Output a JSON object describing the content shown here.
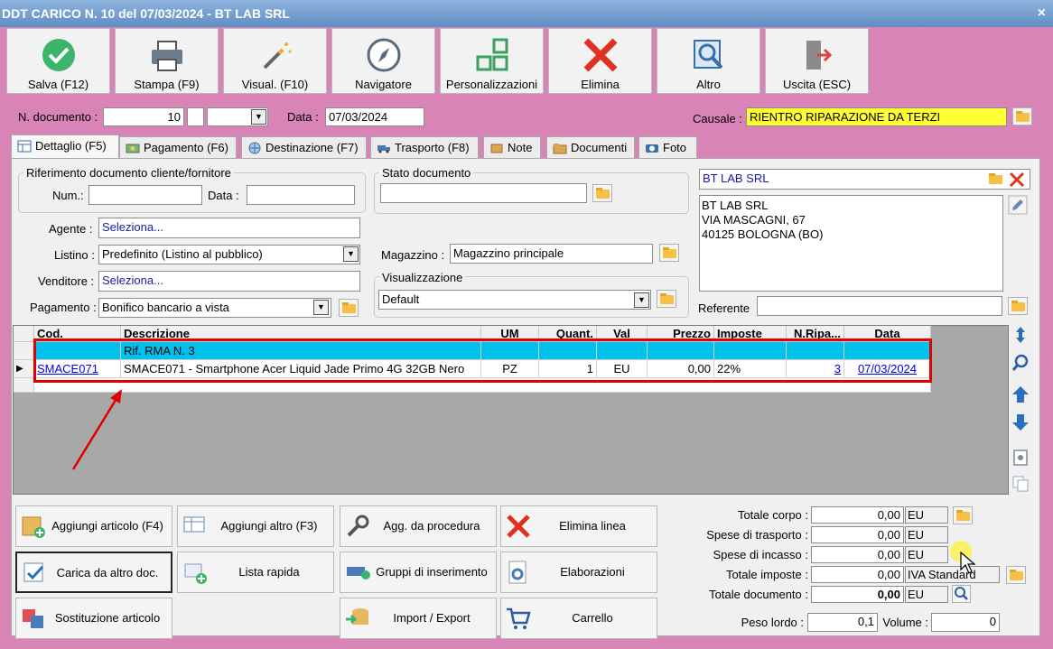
{
  "window": {
    "title": "DDT CARICO N. 10 del 07/03/2024 - BT LAB SRL",
    "close": "×"
  },
  "toolbar": [
    {
      "label": "Salva (F12)",
      "icon": "check-circle-icon"
    },
    {
      "label": "Stampa (F9)",
      "icon": "printer-icon"
    },
    {
      "label": "Visual. (F10)",
      "icon": "magic-wand-icon"
    },
    {
      "label": "Navigatore",
      "icon": "compass-icon"
    },
    {
      "label": "Personalizzazioni",
      "icon": "grid-squares-icon"
    },
    {
      "label": "Elimina",
      "icon": "red-x-icon"
    },
    {
      "label": "Altro",
      "icon": "magnifier-icon"
    },
    {
      "label": "Uscita (ESC)",
      "icon": "exit-door-icon"
    }
  ],
  "header": {
    "ndoc_label": "N. documento :",
    "ndoc_value": "10",
    "data_label": "Data :",
    "data_value": "07/03/2024",
    "causale_label": "Causale :",
    "causale_value": "RIENTRO RIPARAZIONE DA TERZI"
  },
  "tabs": [
    {
      "label": "Dettaglio (F5)",
      "icon": "table-icon",
      "active": true
    },
    {
      "label": "Pagamento (F6)",
      "icon": "money-icon"
    },
    {
      "label": "Destinazione (F7)",
      "icon": "globe-icon"
    },
    {
      "label": "Trasporto (F8)",
      "icon": "truck-icon"
    },
    {
      "label": "Note",
      "icon": "note-icon"
    },
    {
      "label": "Documenti",
      "icon": "folder-icon"
    },
    {
      "label": "Foto",
      "icon": "camera-icon"
    }
  ],
  "riferimento": {
    "title": "Riferimento documento cliente/fornitore",
    "num_label": "Num.:",
    "num_value": "",
    "data_label": "Data :",
    "data_value": ""
  },
  "stato": {
    "title": "Stato documento",
    "value": ""
  },
  "fields": {
    "agente_label": "Agente :",
    "agente_value": "Seleziona...",
    "listino_label": "Listino :",
    "listino_value": "Predefinito (Listino al pubblico)",
    "venditore_label": "Venditore :",
    "venditore_value": "Seleziona...",
    "pagamento_label": "Pagamento :",
    "pagamento_value": "Bonifico bancario a vista",
    "magazzino_label": "Magazzino :",
    "magazzino_value": "Magazzino principale",
    "visualizzazione_title": "Visualizzazione",
    "visualizzazione_value": "Default"
  },
  "cliente": {
    "name": "BT LAB SRL",
    "address_line1": "BT LAB SRL",
    "address_line2": "VIA MASCAGNI, 67",
    "address_line3": "40125 BOLOGNA (BO)",
    "referente_label": "Referente",
    "referente_value": ""
  },
  "grid": {
    "columns": [
      "Cod.",
      "Descrizione",
      "UM",
      "Quant.",
      "Val",
      "Prezzo",
      "Imposte",
      "N.Ripa...",
      "Data"
    ],
    "rows": [
      {
        "cod": "",
        "descrizione": "Rif. RMA N. 3",
        "um": "",
        "quant": "",
        "val": "",
        "prezzo": "",
        "imposte": "",
        "nripa": "",
        "data": ""
      },
      {
        "cod": "SMACE071",
        "descrizione": "SMACE071 - Smartphone Acer Liquid Jade Primo 4G 32GB Nero",
        "um": "PZ",
        "quant": "1",
        "val": "EU",
        "prezzo": "0,00",
        "imposte": "22%",
        "nripa": "3",
        "data": "07/03/2024"
      }
    ]
  },
  "actions": [
    {
      "label": "Aggiungi articolo (F4)",
      "icon": "add-article-icon"
    },
    {
      "label": "Aggiungi altro (F3)",
      "icon": "add-other-icon"
    },
    {
      "label": "Agg. da procedura",
      "icon": "wrench-icon"
    },
    {
      "label": "Elimina linea",
      "icon": "red-x-icon"
    },
    {
      "label": "Carica da altro doc.",
      "icon": "load-doc-icon"
    },
    {
      "label": "Lista rapida",
      "icon": "quick-list-icon"
    },
    {
      "label": "Gruppi di inserimento",
      "icon": "insert-group-icon"
    },
    {
      "label": "Elaborazioni",
      "icon": "process-gear-icon"
    },
    {
      "label": "Sostituzione articolo",
      "icon": "swap-icon"
    },
    {
      "label": "Import / Export",
      "icon": "import-export-icon"
    },
    {
      "label": "Carrello",
      "icon": "cart-icon"
    }
  ],
  "totals": {
    "corpo_label": "Totale corpo :",
    "corpo_value": "0,00",
    "corpo_unit": "EU",
    "trasporto_label": "Spese di trasporto :",
    "trasporto_value": "0,00",
    "trasporto_unit": "EU",
    "incasso_label": "Spese di incasso :",
    "incasso_value": "0,00",
    "incasso_unit": "EU",
    "imposte_label": "Totale imposte :",
    "imposte_value": "0,00",
    "imposte_unit": "IVA Standard",
    "documento_label": "Totale documento :",
    "documento_value": "0,00",
    "documento_unit": "EU",
    "peso_label": "Peso lordo :",
    "peso_value": "0,1",
    "volume_label": "Volume :",
    "volume_value": "0"
  },
  "colors": {
    "window_bg": "#d884b6",
    "selected_row": "#00c0ee",
    "causale_bg": "#ffff33",
    "highlight_box": "#e00000"
  }
}
